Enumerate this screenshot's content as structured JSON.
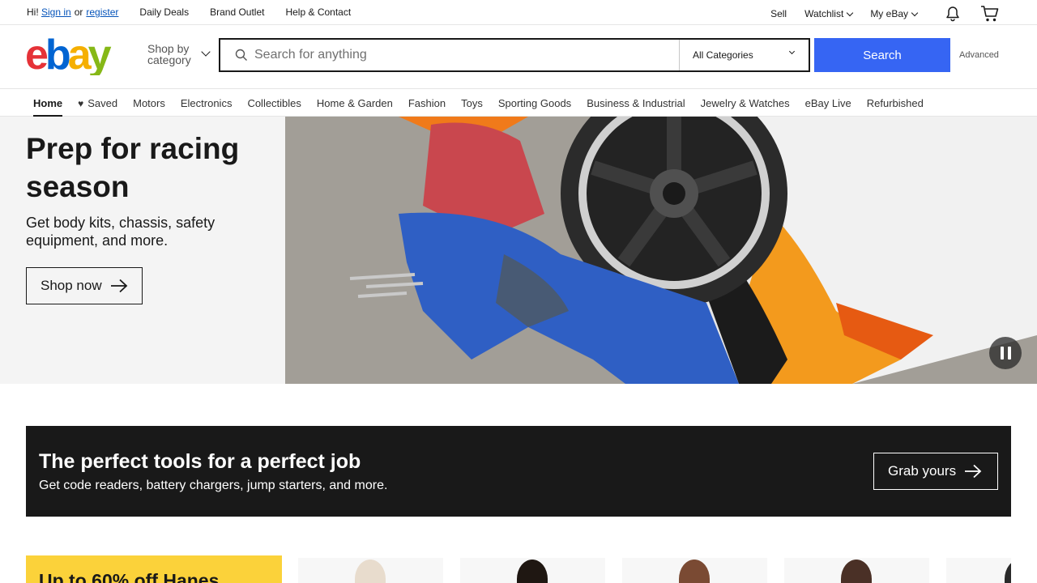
{
  "topbar": {
    "greeting": "Hi!",
    "sign_in": "Sign in",
    "or": "or",
    "register": "register",
    "left_links": [
      "Daily Deals",
      "Brand Outlet",
      "Help & Contact"
    ],
    "sell": "Sell",
    "watchlist": "Watchlist",
    "my_ebay": "My eBay",
    "notification_icon": "bell-icon",
    "cart_icon": "cart-icon"
  },
  "header": {
    "logo_text": "ebay",
    "shop_by_category_line1": "Shop by",
    "shop_by_category_line2": "category",
    "search_placeholder": "Search for anything",
    "category_selected": "All Categories",
    "search_button": "Search",
    "advanced": "Advanced"
  },
  "nav": {
    "items": [
      "Home",
      "Saved",
      "Motors",
      "Electronics",
      "Collectibles",
      "Home & Garden",
      "Fashion",
      "Toys",
      "Sporting Goods",
      "Business & Industrial",
      "Jewelry & Watches",
      "eBay Live",
      "Refurbished"
    ]
  },
  "hero": {
    "title": "Prep for racing season",
    "subtitle": "Get body kits, chassis, safety equipment, and more.",
    "cta": "Shop now"
  },
  "promo": {
    "title": "The perfect tools for a perfect job",
    "subtitle": "Get code readers, battery chargers, jump starters, and more.",
    "cta": "Grab yours"
  },
  "bottom": {
    "yellow_title": "Up to 60% off Hanes"
  },
  "colors": {
    "accent_blue": "#3665f3",
    "promo_bg": "#191919",
    "yellow": "#fbd23a"
  }
}
